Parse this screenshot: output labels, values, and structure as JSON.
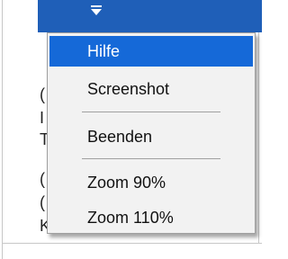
{
  "colors": {
    "titlebar": "#1f5fb8",
    "selected_item": "#1569d8",
    "menu_background": "#f2f2f2"
  },
  "background_text": [
    "(",
    "I",
    "T",
    "(",
    "(",
    "K"
  ],
  "menu": {
    "items": [
      {
        "label": "Hilfe",
        "selected": true
      },
      {
        "label": "Screenshot",
        "selected": false
      },
      {
        "label": "Beenden",
        "selected": false
      },
      {
        "label": "Zoom 90%",
        "selected": false
      },
      {
        "label": "Zoom 110%",
        "selected": false
      }
    ]
  },
  "icons": {
    "dropdown": "menu-dropdown-icon"
  }
}
